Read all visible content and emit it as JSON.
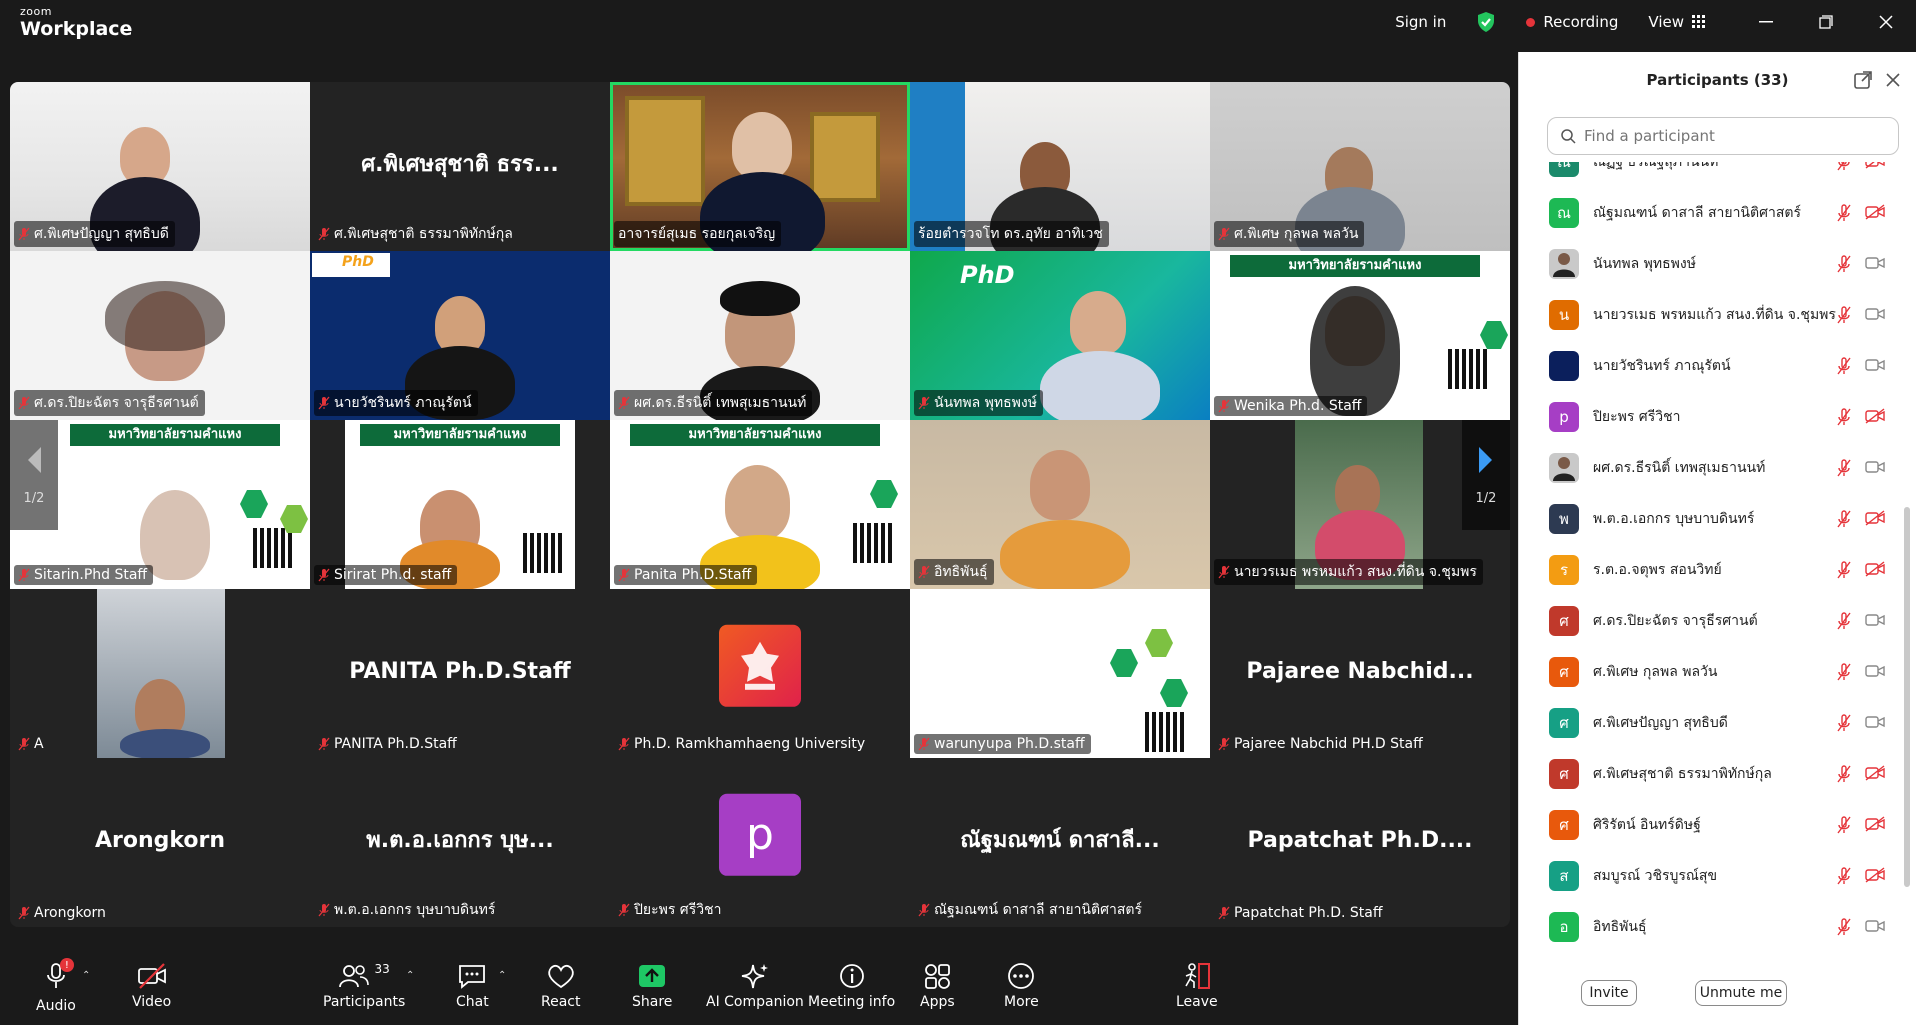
{
  "app": {
    "brand_small": "zoom",
    "brand_big": "Workplace"
  },
  "titlebar": {
    "sign_in": "Sign in",
    "recording": "Recording",
    "view": "View"
  },
  "colors": {
    "accent_green": "#23d962",
    "mute_red": "#e5343a",
    "share_green": "#1ec765",
    "bg_dark": "#1a1a1a"
  },
  "grid": {
    "page_left": "1/2",
    "page_right": "1/2",
    "tiles": [
      {
        "label": "ศ.พิเศษปัญญา สุทธิบดี"
      },
      {
        "label": "ศ.พิเศษสุชาติ ธรรมาพิทักษ์กุล",
        "big": "ศ.พิเศษสุชาติ ธรร..."
      },
      {
        "label": "อาจารย์สุเมธ รอยกุลเจริญ"
      },
      {
        "label": "ร้อยตำรวจโท ดร.อุทัย อาทิเวช"
      },
      {
        "label": "ศ.พิเศษ กุลพล พลวัน"
      },
      {
        "label": "ศ.ดร.ปิยะฉัตร จารุธีรศานต์"
      },
      {
        "label": "นายวัชรินทร์ ภาณุรัตน์"
      },
      {
        "label": "ผศ.ดร.ธีรนิติ์ เทพสุเมธานนท์"
      },
      {
        "label": "นันทพล พุทธพงษ์"
      },
      {
        "label": "Wenika Ph.d. Staff"
      },
      {
        "label": "Sitarin.Phd Staff"
      },
      {
        "label": "Sirirat Ph.d. staff"
      },
      {
        "label": "Panita Ph.D.Staff"
      },
      {
        "label": "อิทธิพันธุ์"
      },
      {
        "label": "นายวรเมธ  พรหมแก้ว  สนง.ที่ดิน จ.ชุมพร"
      },
      {
        "label": "A"
      },
      {
        "label": "PANITA Ph.D.Staff",
        "big": "PANITA Ph.D.Staff"
      },
      {
        "label": "Ph.D. Ramkhamhaeng University"
      },
      {
        "label": "warunyupa Ph.D.staff"
      },
      {
        "label": "Pajaree Nabchid PH.D Staff",
        "big": "Pajaree  Nabchid..."
      },
      {
        "label": "Arongkorn",
        "big": "Arongkorn"
      },
      {
        "label": "พ.ต.อ.เอกกร บุษบาบดินทร์",
        "big": "พ.ต.อ.เอกกร บุษ..."
      },
      {
        "label": "ปิยะพร ศรีวิชา",
        "avatar": "p"
      },
      {
        "label": "ณัฐมณฑน์ ดาสาลี สายานิติศาสตร์",
        "big": "ณัฐมณฑน์ ดาสาลี..."
      },
      {
        "label": "Papatchat Ph.D. Staff",
        "big": "Papatchat  Ph.D...."
      }
    ],
    "poster_text": "มหาวิทยาลัยรามคำแหง",
    "phd_logo": "PhD"
  },
  "toolbar": {
    "audio": "Audio",
    "audio_badge": "!",
    "video": "Video",
    "participants": "Participants",
    "participants_count": "33",
    "chat": "Chat",
    "react": "React",
    "share": "Share",
    "ai": "AI Companion",
    "meeting_info": "Meeting info",
    "apps": "Apps",
    "more": "More",
    "leave": "Leave"
  },
  "panel": {
    "title": "Participants (33)",
    "search_placeholder": "Find a participant",
    "invite": "Invite",
    "unmute": "Unmute me",
    "participants": [
      {
        "initial": "ณ",
        "color": "#1b8a6b",
        "name": "ณัฏฐ์ ธีรณัฐสุภานนท์",
        "cam_off": true
      },
      {
        "initial": "ณ",
        "color": "#1db954",
        "name": "ณัฐมณฑน์ ดาสาลี สายานิติศาสตร์",
        "cam_off": true
      },
      {
        "initial": "",
        "color": "#c9c9c9",
        "name": "นันทพล พุทธพงษ์",
        "cam_off": false,
        "photo": true
      },
      {
        "initial": "น",
        "color": "#e06c00",
        "name": "นายวรเมธ  พรหมแก้ว  สนง.ที่ดิน จ.ชุมพร",
        "cam_off": false
      },
      {
        "initial": "",
        "color": "#0b1f5c",
        "name": "นายวัชรินทร์ ภาณุรัตน์",
        "cam_off": false
      },
      {
        "initial": "p",
        "color": "#a63ec5",
        "name": "ปิยะพร ศรีวิชา",
        "cam_off": true
      },
      {
        "initial": "",
        "color": "#c9c9c9",
        "name": "ผศ.ดร.ธีรนิติ์ เทพสุเมธานนท์",
        "cam_off": false,
        "photo": true
      },
      {
        "initial": "พ",
        "color": "#2d3a52",
        "name": "พ.ต.อ.เอกกร บุษบาบดินทร์",
        "cam_off": true
      },
      {
        "initial": "ร",
        "color": "#f39c12",
        "name": "ร.ต.อ.จตุพร  สอนวิทย์",
        "cam_off": true
      },
      {
        "initial": "ศ",
        "color": "#c0392b",
        "name": "ศ.ดร.ปิยะฉัตร จารุธีรศานต์",
        "cam_off": false
      },
      {
        "initial": "ศ",
        "color": "#e8590c",
        "name": "ศ.พิเศษ กุลพล พลวัน",
        "cam_off": false
      },
      {
        "initial": "ศ",
        "color": "#16a085",
        "name": "ศ.พิเศษปัญญา สุทธิบดี",
        "cam_off": false
      },
      {
        "initial": "ศ",
        "color": "#c0392b",
        "name": "ศ.พิเศษสุชาติ ธรรมาพิทักษ์กุล",
        "cam_off": true
      },
      {
        "initial": "ศ",
        "color": "#e8590c",
        "name": "ศิริรัตน์ อินทร์ดิษฐ์",
        "cam_off": true
      },
      {
        "initial": "ส",
        "color": "#16a085",
        "name": "สมบูรณ์ วชิรบูรณ์สุข",
        "cam_off": true
      },
      {
        "initial": "อ",
        "color": "#1db954",
        "name": "อิทธิพันธุ์",
        "cam_off": false
      }
    ]
  }
}
